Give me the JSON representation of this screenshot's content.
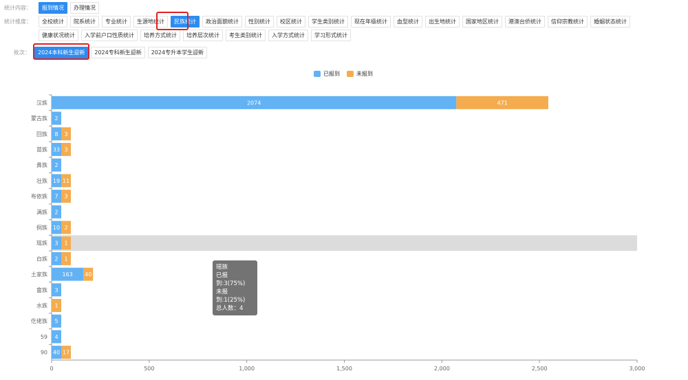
{
  "filters": {
    "content": {
      "label": "统计内容：",
      "options": [
        "报到情况",
        "办理情况"
      ],
      "active": 0
    },
    "dimension": {
      "label": "统计维度：",
      "options": [
        "全校统计",
        "院系统计",
        "专业统计",
        "生源地统计",
        "民族统计",
        "政治面貌统计",
        "性别统计",
        "校区统计",
        "学生类别统计",
        "现在年级统计",
        "血型统计",
        "出生地统计",
        "国家地区统计",
        "港澳台侨统计",
        "信仰宗教统计",
        "婚姻状态统计",
        "健康状况统计",
        "入学前户口性质统计",
        "培养方式统计",
        "培养层次统计",
        "考生类别统计",
        "入学方式统计",
        "学习形式统计"
      ],
      "active": 4
    },
    "batch": {
      "label": "批次：",
      "options": [
        "2024本科新生迎新",
        "2024专科新生迎新",
        "2024专升本学生迎新"
      ],
      "active": 0
    }
  },
  "legend": [
    {
      "name": "已报到",
      "color": "#62b2f4"
    },
    {
      "name": "未报到",
      "color": "#f4ac4f"
    }
  ],
  "chart_data": {
    "type": "bar",
    "orientation": "horizontal",
    "stacked": true,
    "categories": [
      "汉族",
      "蒙古族",
      "回族",
      "苗族",
      "彝族",
      "壮族",
      "布依族",
      "满族",
      "侗族",
      "瑶族",
      "白族",
      "土家族",
      "畲族",
      "水族",
      "仡佬族",
      "59",
      "90"
    ],
    "series": [
      {
        "name": "已报到",
        "color": "#62b2f4",
        "values": [
          2074,
          2,
          8,
          33,
          2,
          19,
          7,
          2,
          10,
          3,
          2,
          163,
          3,
          0,
          5,
          4,
          40
        ]
      },
      {
        "name": "未报到",
        "color": "#f4ac4f",
        "values": [
          471,
          0,
          3,
          3,
          0,
          11,
          3,
          0,
          2,
          1,
          1,
          40,
          0,
          1,
          0,
          0,
          17
        ]
      }
    ],
    "xlim": [
      0,
      3000
    ],
    "xticks": [
      0,
      500,
      1000,
      1500,
      2000,
      2500,
      3000
    ],
    "xtick_labels": [
      "0",
      "500",
      "1,000",
      "1,500",
      "2,000",
      "2,500",
      "3,000"
    ],
    "highlighted_category_index": 9
  },
  "tooltip": {
    "title": "瑶族",
    "line1": "已报到:3(75%)",
    "line2": "未报到:1(25%)",
    "line3": "总人数：4"
  }
}
